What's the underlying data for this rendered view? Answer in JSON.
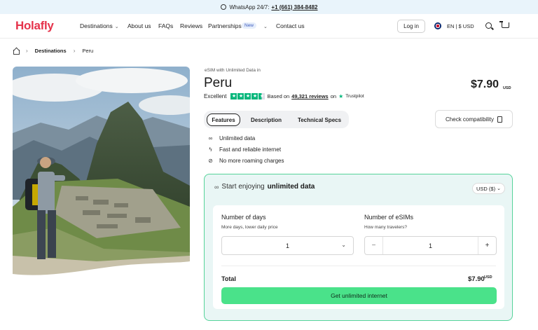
{
  "topbar": {
    "label": "WhatsApp 24/7:",
    "phone": "+1 (661) 384-8482"
  },
  "nav": {
    "logo": "Holafly",
    "destinations": "Destinations",
    "about": "About us",
    "faqs": "FAQs",
    "reviews": "Reviews",
    "partnerships": "Partnerships",
    "new_badge": "New",
    "contact": "Contact us",
    "login": "Log in",
    "locale": "EN | $ USD"
  },
  "breadcrumb": {
    "level1": "Destinations",
    "level2": "Peru"
  },
  "product": {
    "eyebrow": "eSIM with Unlimited Data in",
    "title": "Peru",
    "price": "$7.90",
    "currency": "USD",
    "rating_label": "Excellent",
    "rating_stars": 4.5,
    "based_on": "Based on",
    "reviews": "49,321 reviews",
    "on": "on",
    "platform": "Trustpilot"
  },
  "tabs": [
    "Features",
    "Description",
    "Technical Specs"
  ],
  "check_compat": "Check compatibility",
  "features": [
    "Unlimited data",
    "Fast and reliable internet",
    "No more roaming charges"
  ],
  "plan": {
    "head_prefix": "Start enjoying",
    "head_bold": "unlimited data",
    "currency_select": "USD ($)",
    "days_label": "Number of days",
    "days_sub": "More days, lower daily price",
    "days_value": "1",
    "esims_label": "Number of eSIMs",
    "esims_sub": "How many travelers?",
    "esims_value": "1",
    "minus": "−",
    "plus": "+",
    "total_label": "Total",
    "total_price": "$7.90",
    "total_currency": "USD",
    "cta": "Get unlimited internet"
  },
  "colors": {
    "brand": "#e5334b",
    "cta": "#4ae28a",
    "card_border": "#56d39a",
    "trustpilot": "#00b67a"
  },
  "icons": [
    "whatsapp-icon",
    "home-icon",
    "search-icon",
    "cart-icon",
    "flag-icon",
    "infinity-icon",
    "bolt-icon",
    "no-roaming-icon",
    "phone-check-icon"
  ]
}
